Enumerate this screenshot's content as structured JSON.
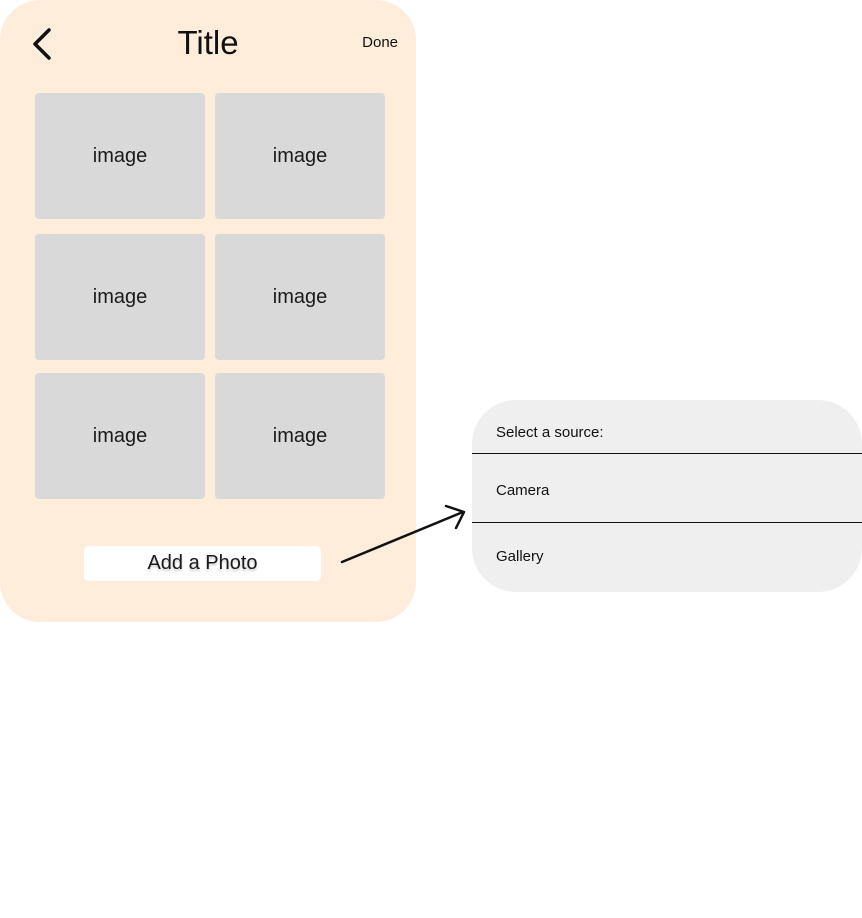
{
  "header": {
    "back_icon": "chevron-left-icon",
    "title": "Title",
    "done_label": "Done"
  },
  "gallery": {
    "tiles": [
      "image",
      "image",
      "image",
      "image",
      "image",
      "image"
    ]
  },
  "add_photo_label": "Add a Photo",
  "source_sheet": {
    "header": "Select a source:",
    "options": [
      "Camera",
      "Gallery"
    ]
  },
  "colors": {
    "phone_background": "#ffeddc",
    "tile_background": "#d9d9d9",
    "sheet_background": "#efefef",
    "button_background": "#ffffff"
  }
}
